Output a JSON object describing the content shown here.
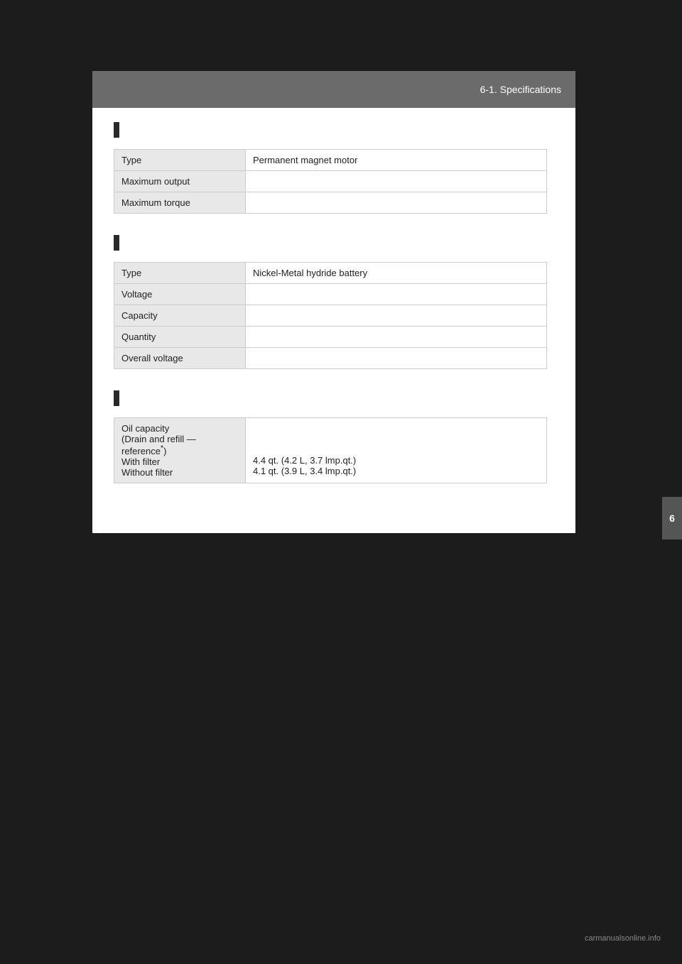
{
  "page": {
    "background_color": "#1c1c1c",
    "header": {
      "section_label": "6-1. Specifications",
      "background_color": "#6b6b6b"
    },
    "side_tab": {
      "label": "6"
    },
    "watermark": "carmanualsonline.info"
  },
  "sections": {
    "motor": {
      "rows": [
        {
          "label": "Type",
          "value": "Permanent magnet motor"
        },
        {
          "label": "Maximum output",
          "value": ""
        },
        {
          "label": "Maximum torque",
          "value": ""
        }
      ]
    },
    "battery": {
      "rows": [
        {
          "label": "Type",
          "value": "Nickel-Metal hydride battery"
        },
        {
          "label": "Voltage",
          "value": ""
        },
        {
          "label": "Capacity",
          "value": ""
        },
        {
          "label": "Quantity",
          "value": ""
        },
        {
          "label": "Overall voltage",
          "value": ""
        }
      ]
    },
    "oil": {
      "rows": [
        {
          "label": "Oil capacity\n(Drain and refill —\nreference*)\nWith filter\nWithout filter",
          "label_line1": "Oil capacity",
          "label_line2": "(Drain and refill —",
          "label_line3": "reference*)",
          "label_line4": "With filter",
          "label_line5": "Without filter",
          "value_line1": "",
          "value_line2": "",
          "value_line3": "",
          "value_with_filter": "4.4 qt. (4.2 L, 3.7 lmp.qt.)",
          "value_without_filter": "4.1 qt. (3.9 L, 3.4 lmp.qt.)"
        }
      ]
    }
  }
}
